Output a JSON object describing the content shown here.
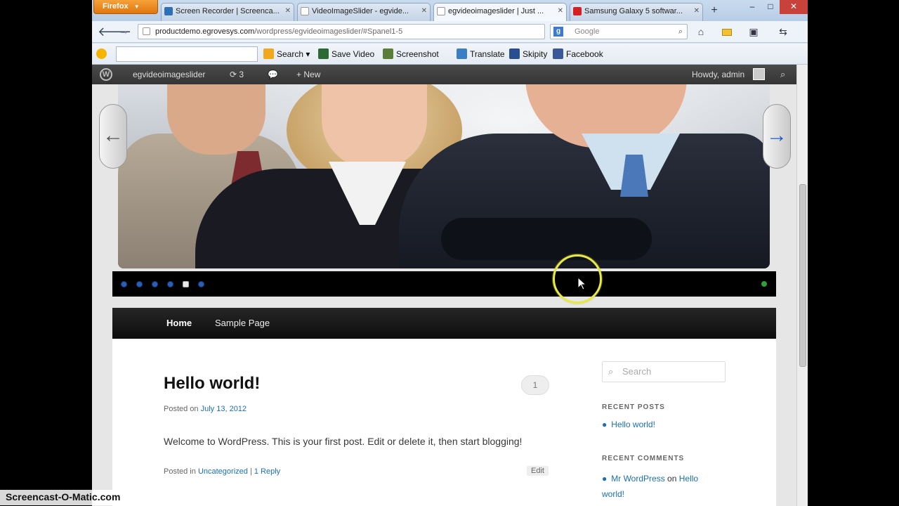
{
  "browser": {
    "app_button": "Firefox",
    "tabs": [
      {
        "label": "Screen Recorder | Screenca...",
        "favicon_color": "#2f6fb3"
      },
      {
        "label": "VideoImageSlider - egvide...",
        "favicon_color": "#ffffff"
      },
      {
        "label": "egvideoimageslider | Just ...",
        "favicon_color": "#ffffff"
      },
      {
        "label": "Samsung Galaxy 5 softwar...",
        "favicon_color": "#d42020"
      }
    ],
    "new_tab": "+",
    "url_host": "productdemo.egrovesys.com",
    "url_path": "/wordpress/egvideoimageslider/#Spanel1-5",
    "search_placeholder": "Google",
    "bookmarks": {
      "search_label": "Search",
      "items": [
        "Save Video",
        "Screenshot",
        "Translate",
        "Skipity",
        "Facebook"
      ]
    }
  },
  "adminbar": {
    "site_name": "egvideoimageslider",
    "updates_count": "3",
    "new_label": "New",
    "howdy": "Howdy, admin"
  },
  "slider": {
    "prev_glyph": "←",
    "next_glyph": "→",
    "dots_count": 6,
    "active_dot": 5
  },
  "site_nav": {
    "items": [
      "Home",
      "Sample Page"
    ]
  },
  "post": {
    "title": "Hello world!",
    "comment_count": "1",
    "posted_on_prefix": "Posted on",
    "date": "July 13, 2012",
    "body": "Welcome to WordPress. This is your first post. Edit or delete it, then start blogging!",
    "posted_in_prefix": "Posted in",
    "category": "Uncategorized",
    "separator": "|",
    "reply": "1 Reply",
    "edit": "Edit"
  },
  "sidebar": {
    "search_placeholder": "Search",
    "recent_posts_title": "RECENT POSTS",
    "recent_post": "Hello world!",
    "recent_comments_title": "RECENT COMMENTS",
    "comment_author": "Mr WordPress",
    "comment_on": "on",
    "comment_post_line1": "Hello",
    "comment_post_line2": "world!"
  },
  "watermark": "Screencast-O-Matic.com",
  "colors": {
    "accent_link": "#1b6fb3",
    "slider_dot": "#2a5fb8",
    "highlight_ring": "#e6e84a"
  }
}
